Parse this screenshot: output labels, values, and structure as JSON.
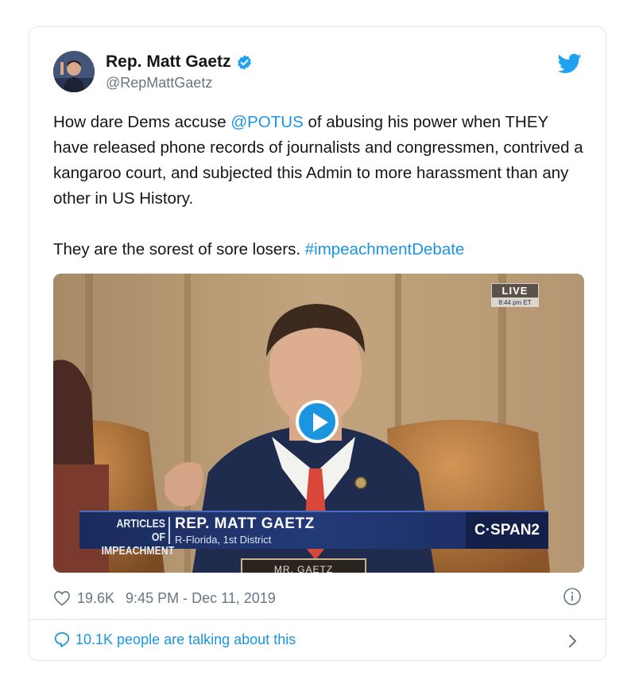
{
  "author": {
    "name": "Rep. Matt Gaetz",
    "handle": "@RepMattGaetz",
    "verified": true
  },
  "tweet": {
    "text_part1": "How dare Dems accuse ",
    "mention": "@POTUS",
    "text_part2": " of abusing his power when THEY have released phone records of journalists and congressmen, contrived a kangaroo court, and subjected this Admin to more harassment than any other in US History.",
    "text_part3": "They are the sorest of sore losers. ",
    "hashtag": "#impeachmentDebate"
  },
  "media": {
    "live_label": "LIVE",
    "live_time": "8:44 pm ET",
    "lower_third_left": "ARTICLES OF IMPEACHMENT",
    "lower_third_name": "REP. MATT GAETZ",
    "lower_third_district": "R-Florida, 1st District",
    "network": "C·SPAN2",
    "nameplate": "MR. GAETZ"
  },
  "meta": {
    "likes": "19.6K",
    "timestamp": "9:45 PM - Dec 11, 2019"
  },
  "conversation": {
    "text": "10.1K people are talking about this"
  },
  "colors": {
    "link": "#1b95e0",
    "text": "#14171a",
    "muted": "#657786",
    "border": "#e1e8ed"
  }
}
